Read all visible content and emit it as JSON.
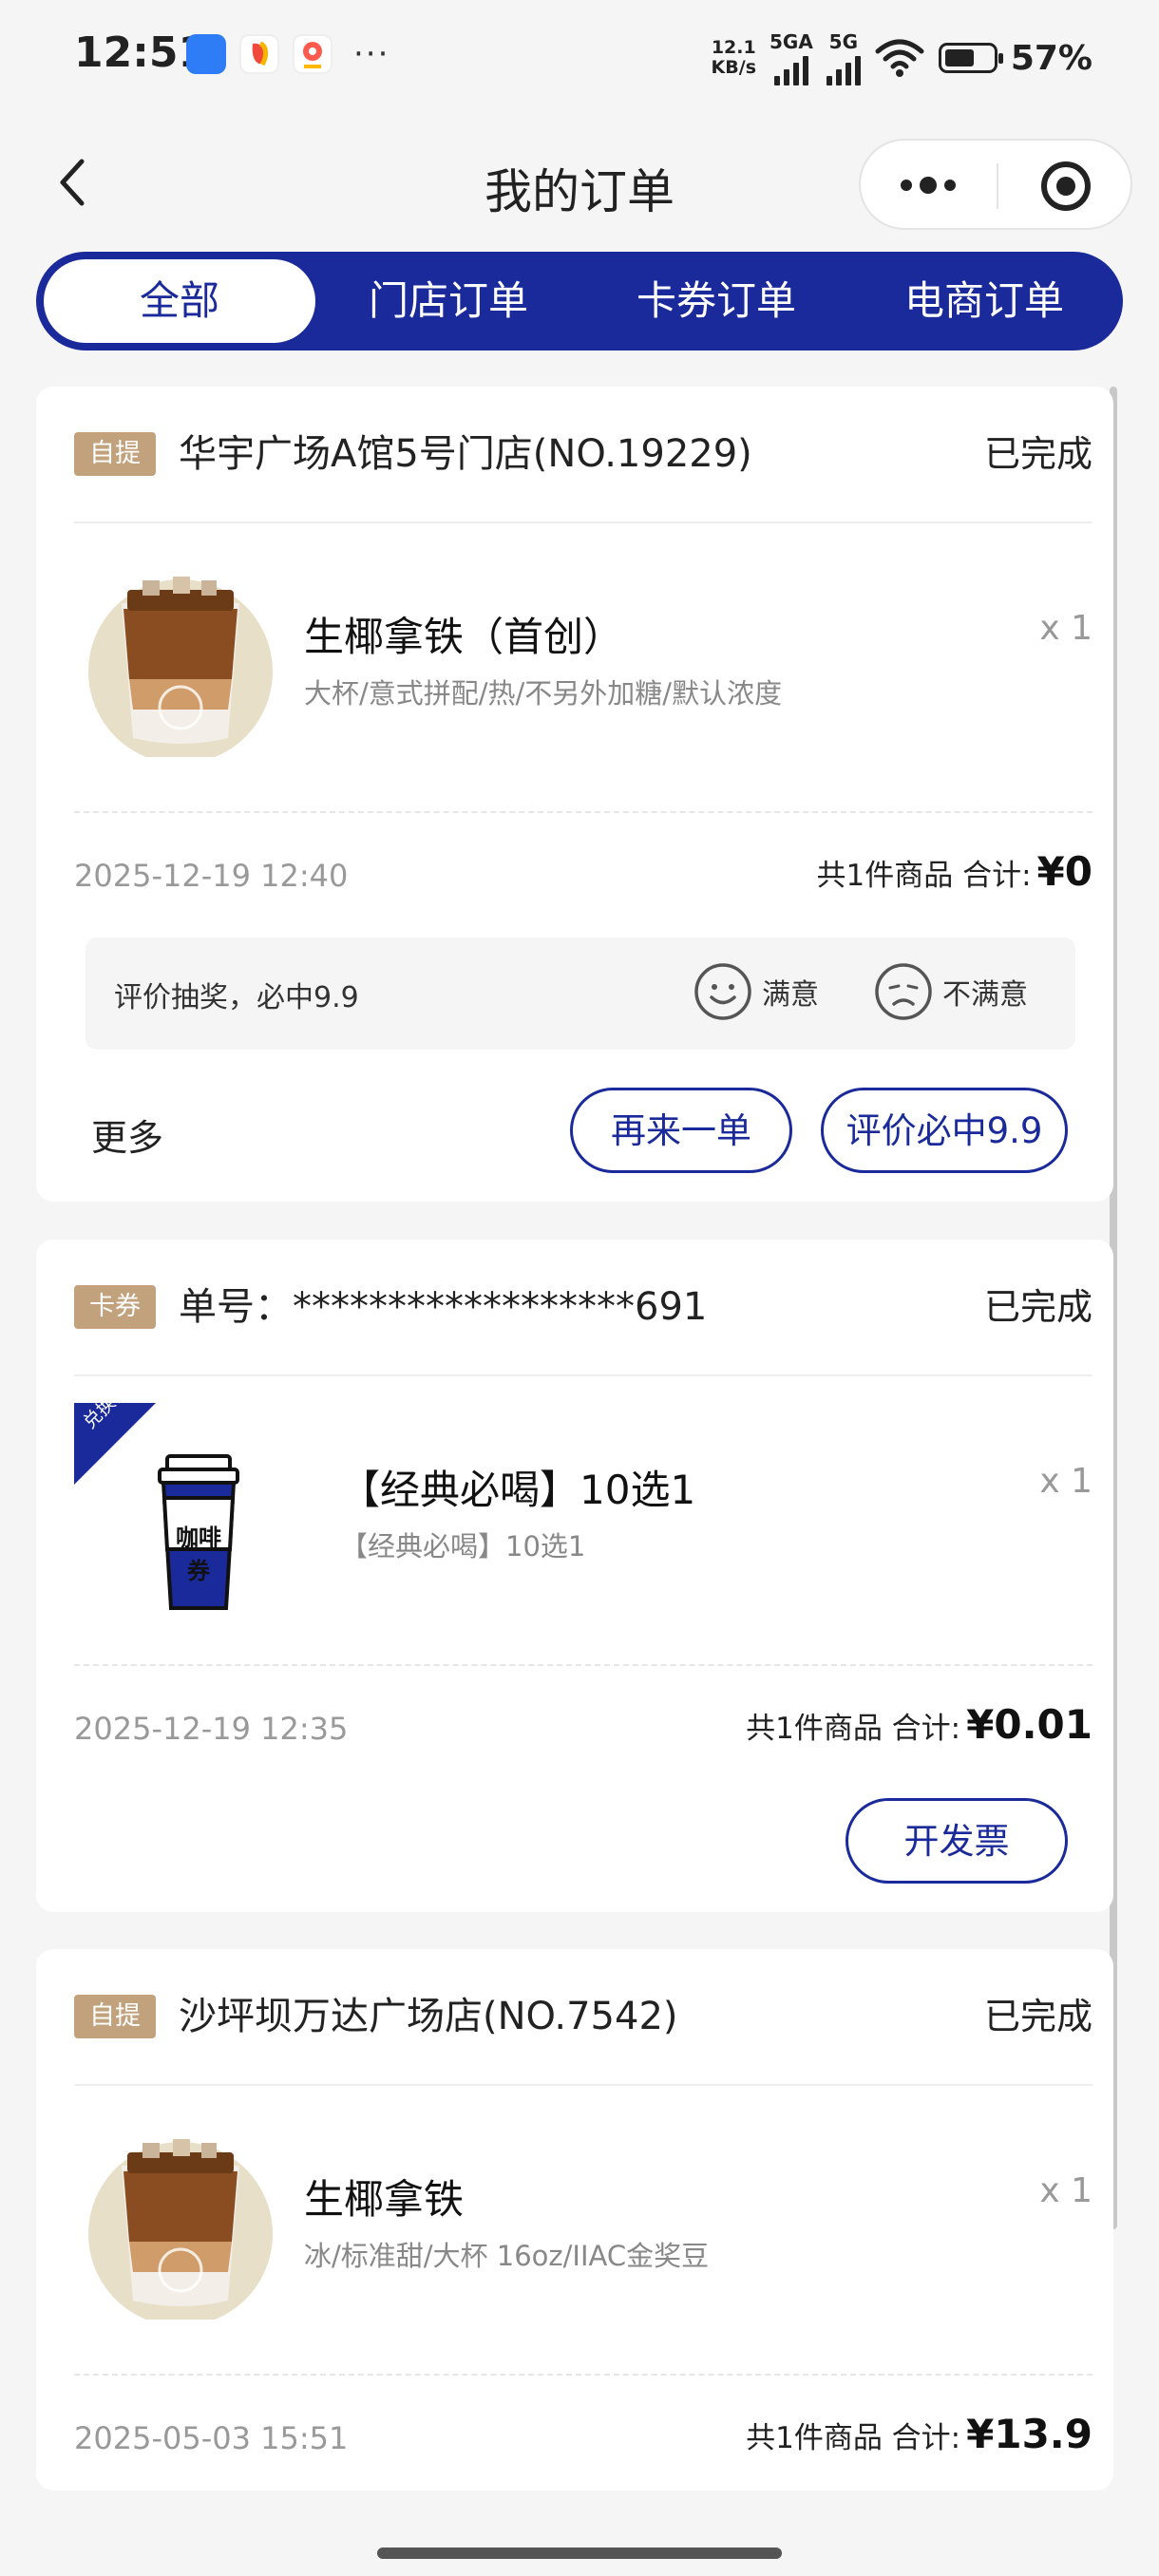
{
  "status_bar": {
    "time": "12:51",
    "speed_value": "12.1",
    "speed_unit": "KB/s",
    "network1": "5GA",
    "network2": "5G",
    "battery": "57%"
  },
  "nav": {
    "title": "我的订单"
  },
  "tabs": [
    {
      "label": "全部",
      "active": true
    },
    {
      "label": "门店订单",
      "active": false
    },
    {
      "label": "卡券订单",
      "active": false
    },
    {
      "label": "电商订单",
      "active": false
    }
  ],
  "orders": [
    {
      "tag": "自提",
      "store": "华宇广场A馆5号门店(NO.19229)",
      "status": "已完成",
      "product_name": "生椰拿铁（首创）",
      "product_spec": "大杯/意式拼配/热/不另外加糖/默认浓度",
      "qty": "x 1",
      "date": "2025-12-19 12:40",
      "total_label": "共1件商品 合计:",
      "price": "¥0",
      "rating": {
        "text": "评价抽奖，必中9.9",
        "satisfied": "满意",
        "unsatisfied": "不满意"
      },
      "more": "更多",
      "btn_reorder": "再来一单",
      "btn_review": "评价必中9.9"
    },
    {
      "tag": "卡券",
      "store": "单号：******************691",
      "status": "已完成",
      "corner_badge": "兑换券",
      "coupon_cup_label": "咖啡券",
      "product_name": "【经典必喝】10选1",
      "product_spec": "【经典必喝】10选1",
      "qty": "x 1",
      "date": "2025-12-19 12:35",
      "total_label": "共1件商品 合计:",
      "price": "¥0.01",
      "btn_invoice": "开发票"
    },
    {
      "tag": "自提",
      "store": "沙坪坝万达广场店(NO.7542)",
      "status": "已完成",
      "product_name": "生椰拿铁",
      "product_spec": "冰/标准甜/大杯 16oz/IIAC金奖豆",
      "qty": "x 1",
      "date": "2025-05-03 15:51",
      "total_label": "共1件商品 合计:",
      "price": "¥13.9"
    }
  ],
  "colors": {
    "brand_blue": "#1a2a9a",
    "tag_gold": "#c2a27d",
    "background": "#f5f5f5"
  }
}
